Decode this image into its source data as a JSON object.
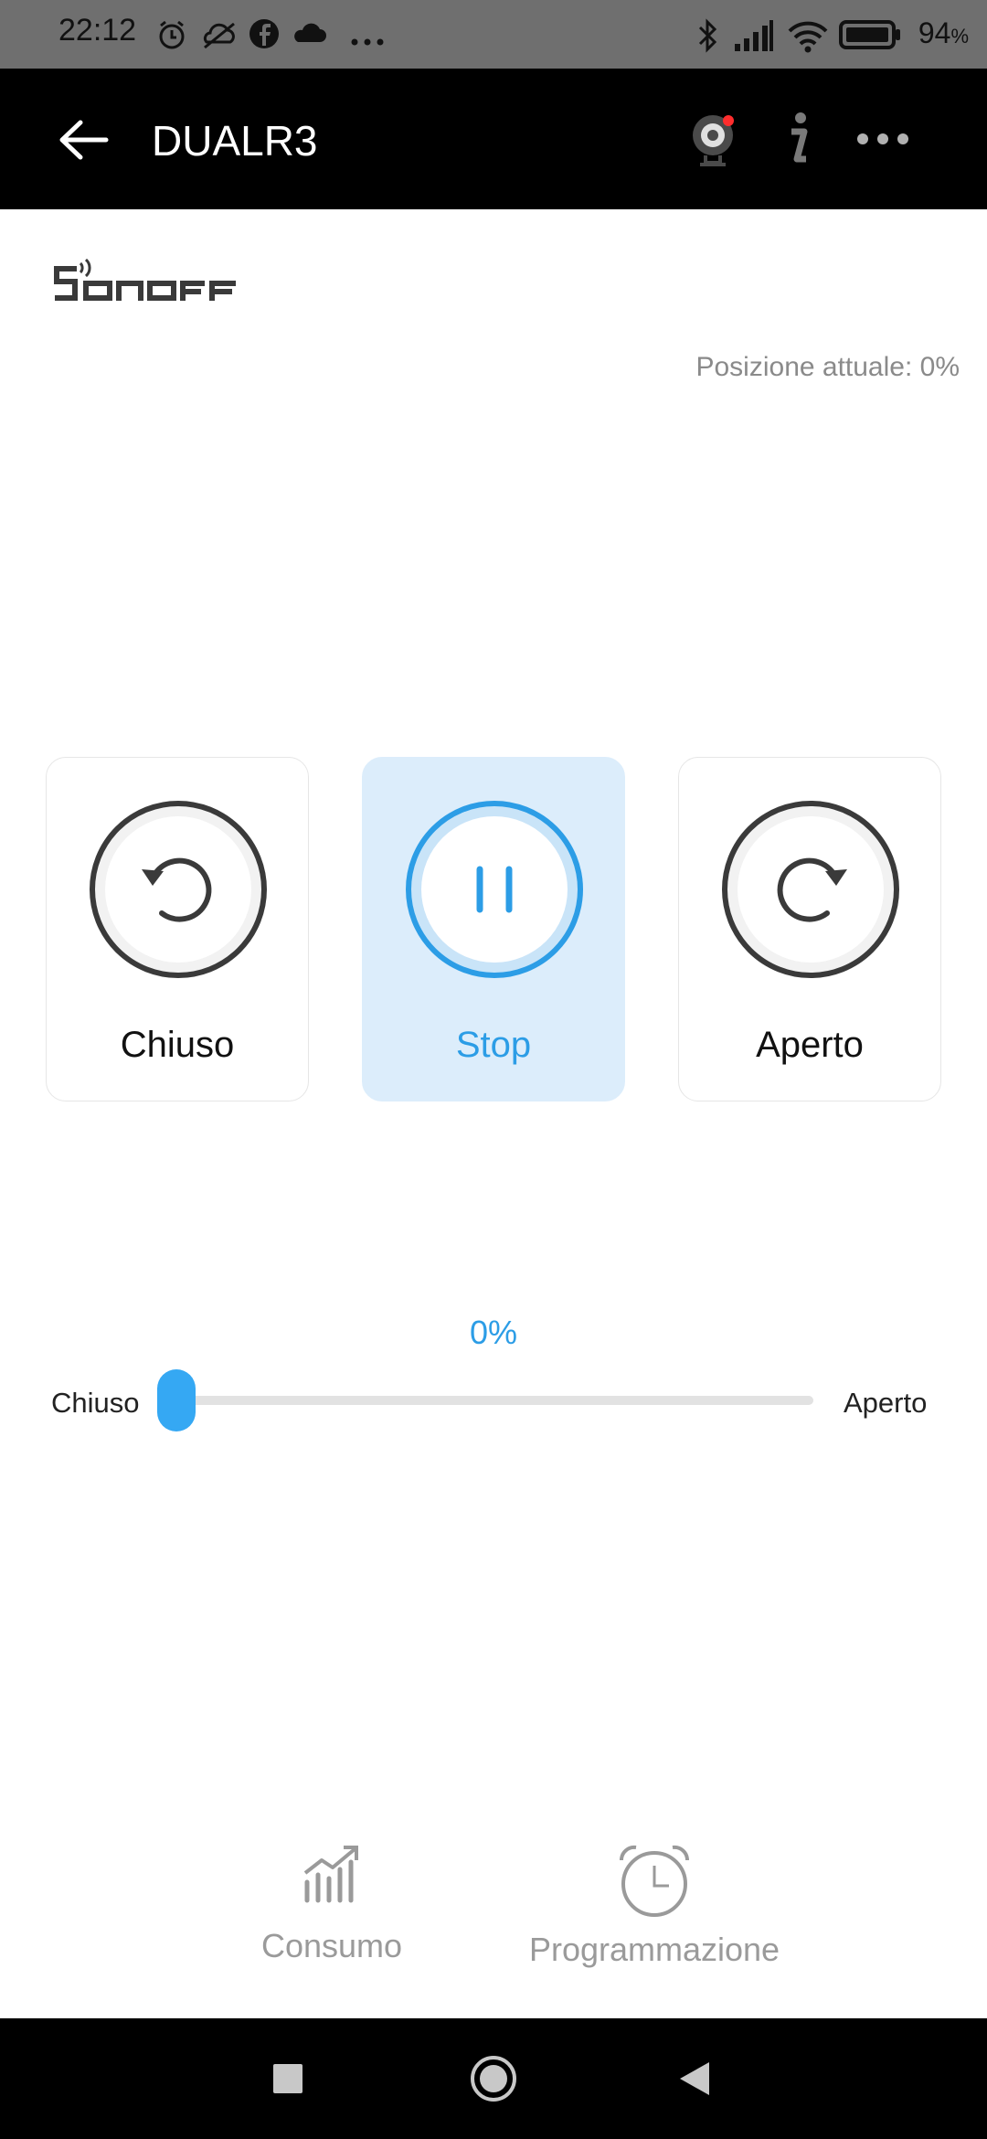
{
  "status_bar": {
    "time": "22:12",
    "battery": "94",
    "battery_unit": "%",
    "icons_left": [
      "alarm-icon",
      "weather-icon",
      "facebook-icon",
      "cloud-icon",
      "more-dots-icon"
    ],
    "icons_right": [
      "bluetooth-icon",
      "signal-icon",
      "wifi-icon",
      "battery-icon"
    ]
  },
  "app_bar": {
    "title": "DUALR3",
    "actions": [
      "camera-icon",
      "info-icon",
      "more-icon"
    ],
    "camera_badge_color": "#ff2d2d"
  },
  "brand": {
    "logo_text": "SONOFF"
  },
  "position_text": "Posizione attuale: 0%",
  "controls": [
    {
      "label": "Chiuso",
      "icon": "rotate-ccw-icon",
      "active": false
    },
    {
      "label": "Stop",
      "icon": "pause-icon",
      "active": true
    },
    {
      "label": "Aperto",
      "icon": "rotate-cw-icon",
      "active": false
    }
  ],
  "slider": {
    "value_text": "0%",
    "value": 0,
    "left_label": "Chiuso",
    "right_label": "Aperto"
  },
  "bottom_tabs": [
    {
      "label": "Consumo",
      "icon": "chart-icon"
    },
    {
      "label": "Programmazione",
      "icon": "alarm-clock-icon"
    }
  ],
  "nav_bar": [
    "recents-icon",
    "home-icon",
    "back-icon"
  ],
  "colors": {
    "accent": "#2c9de6",
    "active_card": "#dcedfb",
    "app_bar": "#000000",
    "status_bar": "#6f6f6f"
  }
}
